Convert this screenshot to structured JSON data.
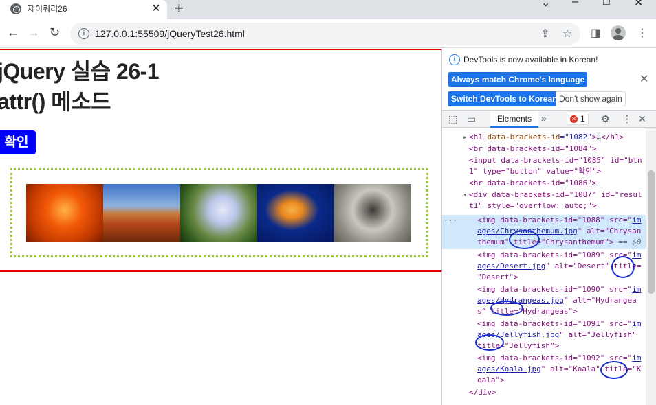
{
  "browser": {
    "tab_title": "제이쿼리26",
    "tab_close": "✕",
    "new_tab": "+",
    "url": "127.0.0.1:55509/jQueryTest26.html"
  },
  "page": {
    "heading1": "jQuery 실습 26-1",
    "heading2": "attr() 메소드",
    "button_label": "확인",
    "images": [
      {
        "name": "Chrysanthemum",
        "colors": [
          "#f35a08",
          "#b32e00"
        ]
      },
      {
        "name": "Desert",
        "colors": [
          "#3d74c9",
          "#b2451a"
        ]
      },
      {
        "name": "Hydrangeas",
        "colors": [
          "#2f5a1c",
          "#bcc6ea"
        ]
      },
      {
        "name": "Jellyfish",
        "colors": [
          "#04155a",
          "#e9881f"
        ]
      },
      {
        "name": "Koala",
        "colors": [
          "#c9c7bf",
          "#5f5c55"
        ]
      }
    ],
    "accent_colors": {
      "rule": "#e00000",
      "button": "#0000ff",
      "border": "#99cc33"
    }
  },
  "devtools": {
    "notice": "DevTools is now available in Korean!",
    "btn_match": "Always match Chrome's language",
    "btn_switch": "Switch DevTools to Korean",
    "btn_dismiss": "Don't show again",
    "tab_elements": "Elements",
    "error_count": "1",
    "code": {
      "l1a": "<h1 ",
      "l1b": "data-brackets-id",
      "l1c": "=\"1082\"",
      "l1d": ">",
      "l1e": "…",
      "l1f": "</h1>",
      "l2": "<br data-brackets-id=\"1084\">",
      "l3a": "<input data-brackets-id=\"1085\" id=\"btn",
      "l3b": "1\" type=\"button\" value=\"확인\">",
      "l4": "<br data-brackets-id=\"1086\">",
      "l5a": "<div data-brackets-id=\"1087\" id=\"resul",
      "l5b": "t1\" style=\"overflow: auto;\">",
      "l6a": "<img data-brackets-id=\"1088\" src=\"",
      "l6b": "im",
      "l6c": "ages/Chrysanthemum.jpg",
      "l6d": "\" alt=\"Chrysan",
      "l6e": "themum\" title=\"Chrysanthemum\">",
      "l6f": " == $0",
      "l7a": "<img data-brackets-id=\"1089\" src=\"",
      "l7b": "im",
      "l7c": "ages/Desert.jpg",
      "l7d": "\" alt=\"Desert\" title=",
      "l7e": "\"Desert\">",
      "l8a": "<img data-brackets-id=\"1090\" src=\"",
      "l8b": "im",
      "l8c": "ages/Hydrangeas.jpg",
      "l8d": "\" alt=\"Hydrangea",
      "l8e": "s\" title=\"Hydrangeas\">",
      "l9a": "<img data-brackets-id=\"1091\" src=\"",
      "l9b": "im",
      "l9c": "ages/Jellyfish.jpg",
      "l9d": "\" alt=\"Jellyfish\"",
      "l9e": "title=\"Jellyfish\">",
      "l10a": "<img data-brackets-id=\"1092\" src=\"",
      "l10b": "im",
      "l10c": "ages/Koala.jpg",
      "l10d": "\" alt=\"Koala\" title=\"K",
      "l10e": "oala\">",
      "l11": "</div>",
      "ellipsis": "..."
    }
  }
}
